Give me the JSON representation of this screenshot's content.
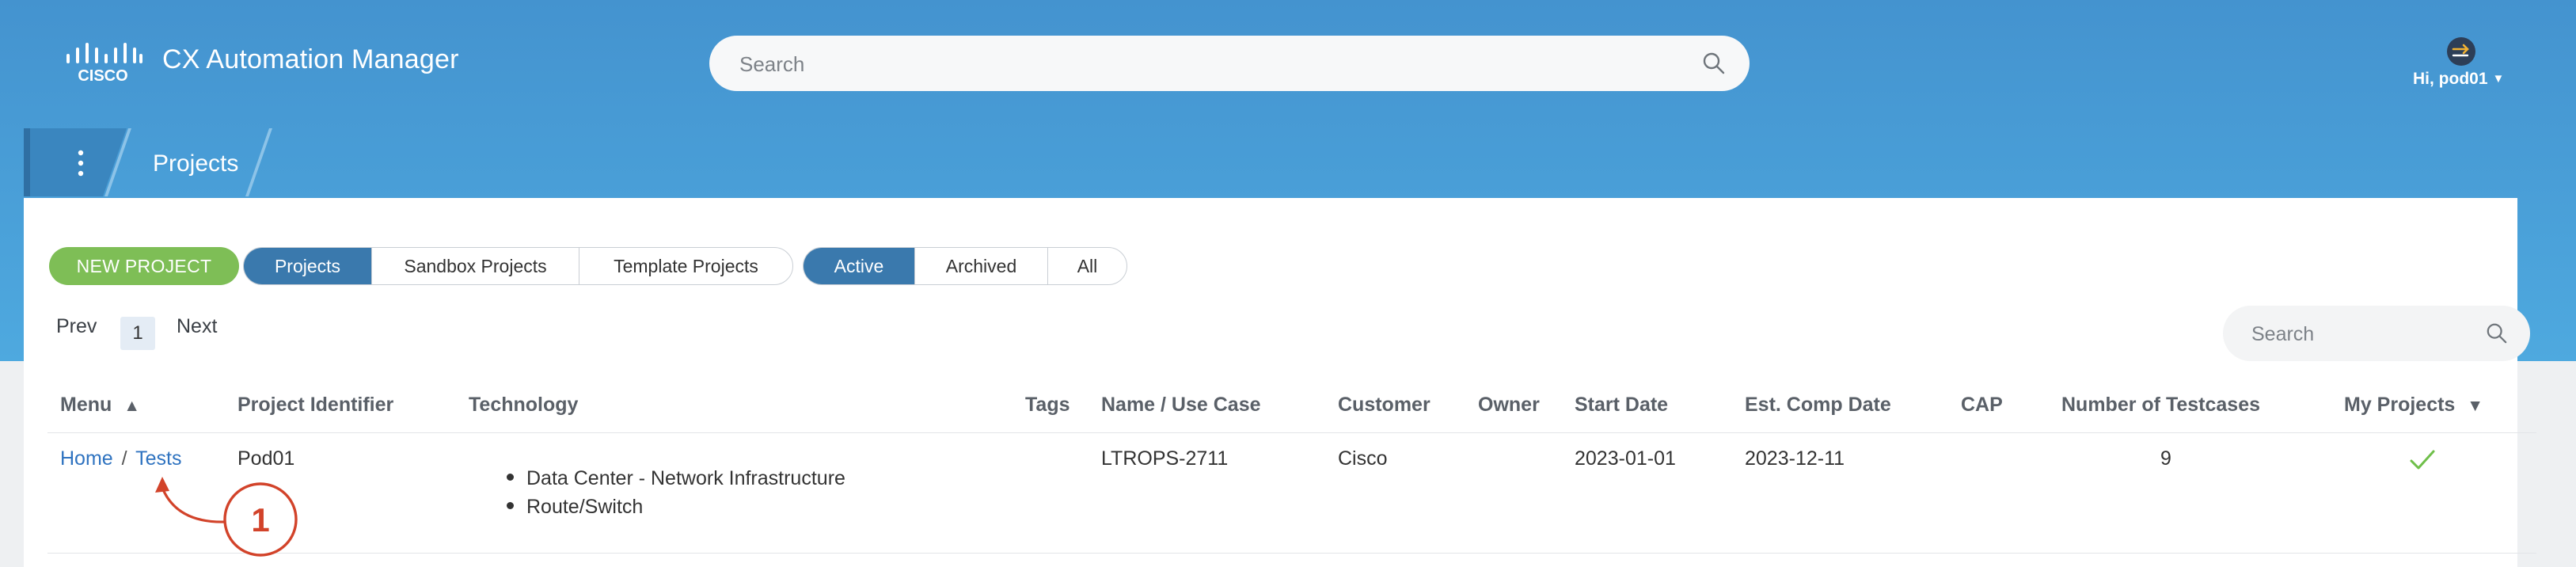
{
  "header": {
    "logo_text": "CISCO",
    "app_title": "CX Automation Manager",
    "search_placeholder": "Search",
    "user_greeting": "Hi, pod01",
    "avatar_icon": "exit-arrow-icon"
  },
  "breadcrumb": {
    "menu_icon": "kebab-menu-icon",
    "label": "Projects"
  },
  "toolbar": {
    "new_project_label": "NEW PROJECT",
    "project_tabs": [
      "Projects",
      "Sandbox Projects",
      "Template Projects"
    ],
    "status_filters": [
      "Active",
      "Archived",
      "All"
    ],
    "active_project_tab": "Projects",
    "active_status_filter": "Active"
  },
  "pagination": {
    "prev_label": "Prev",
    "current_page": "1",
    "next_label": "Next"
  },
  "table_search": {
    "placeholder": "Search"
  },
  "table": {
    "columns": {
      "menu": "Menu",
      "project_identifier": "Project Identifier",
      "technology": "Technology",
      "tags": "Tags",
      "name_use_case": "Name / Use Case",
      "customer": "Customer",
      "owner": "Owner",
      "start_date": "Start Date",
      "est_comp_date": "Est. Comp Date",
      "cap": "CAP",
      "number_of_testcases": "Number of Testcases",
      "my_projects": "My Projects"
    },
    "sort_up_glyph": "▲",
    "sort_down_glyph": "▼",
    "rows": [
      {
        "menu_home": "Home",
        "menu_sep": "/",
        "menu_tests": "Tests",
        "project_identifier": "Pod01",
        "technology": [
          "Data Center - Network Infrastructure",
          "Route/Switch"
        ],
        "tags": "",
        "name_use_case": "LTROPS-2711",
        "customer": "Cisco",
        "owner": "",
        "start_date": "2023-01-01",
        "est_comp_date": "2023-12-11",
        "cap": "",
        "number_of_testcases": "9",
        "my_project_icon": "checkmark-icon"
      }
    ]
  },
  "annotation": {
    "number": "1"
  },
  "colors": {
    "header_gradient_top": "#4493cf",
    "header_gradient_bottom": "#4ea9df",
    "new_project_green": "#7ebe56",
    "active_tab_blue": "#3a79ad",
    "link_blue": "#2f73c0",
    "check_green": "#6fbf4a",
    "annotation_red": "#d2432a"
  }
}
